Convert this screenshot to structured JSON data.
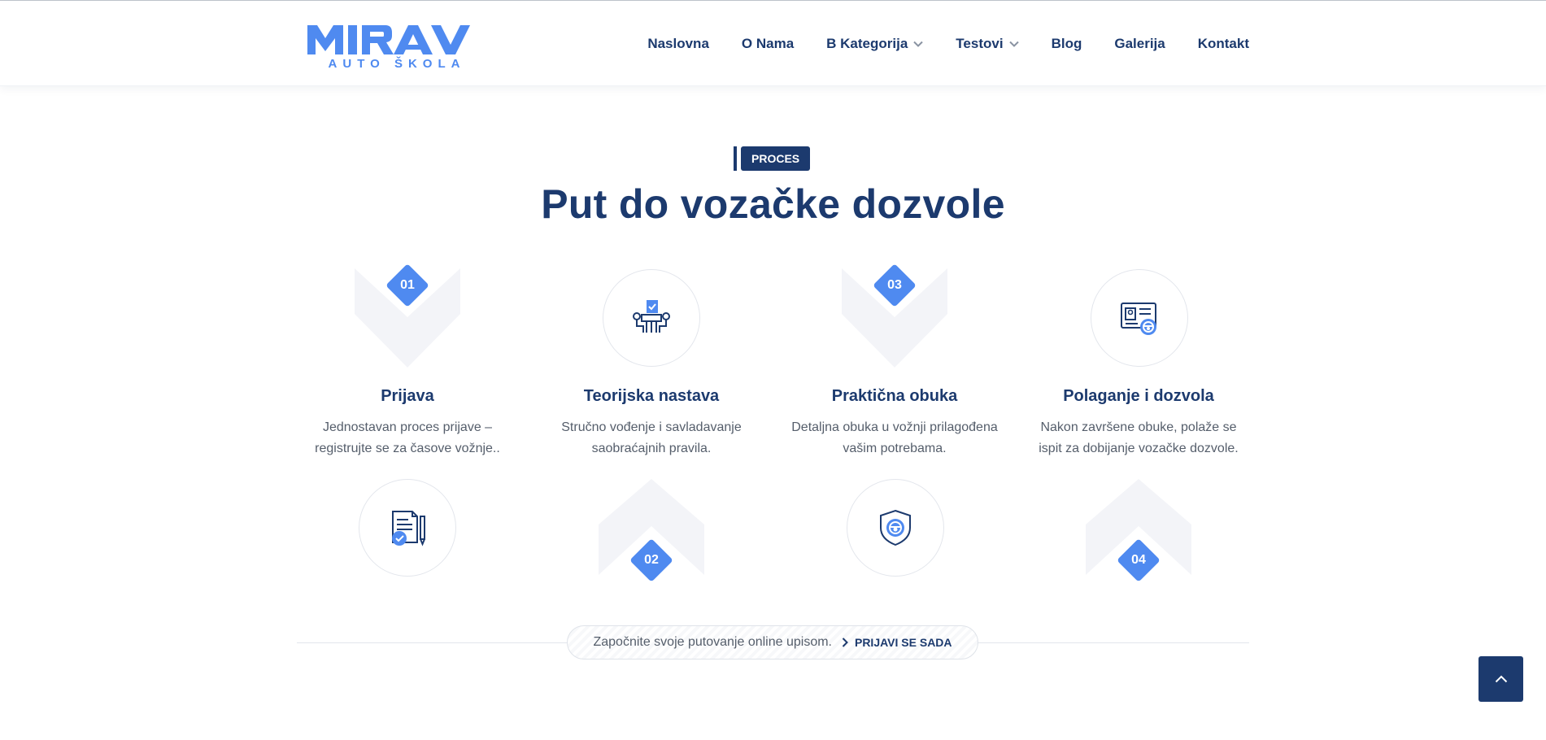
{
  "brand": {
    "name": "MIRAV",
    "subtitle": "AUTO ŠKOLA",
    "color": "#4f8af0"
  },
  "nav": {
    "items": [
      {
        "label": "Naslovna",
        "dropdown": false
      },
      {
        "label": "O Nama",
        "dropdown": false
      },
      {
        "label": "B Kategorija",
        "dropdown": true
      },
      {
        "label": "Testovi",
        "dropdown": true
      },
      {
        "label": "Blog",
        "dropdown": false
      },
      {
        "label": "Galerija",
        "dropdown": false
      },
      {
        "label": "Kontakt",
        "dropdown": false
      }
    ]
  },
  "section": {
    "tag": "PROCES",
    "title": "Put do vozačke dozvole"
  },
  "steps": [
    {
      "number": "01",
      "title": "Prijava",
      "desc_line1": "Jednostavan proces prijave –",
      "desc_line2": "registrujte se za časove vožnje..",
      "icon": "document-check-icon"
    },
    {
      "number": "02",
      "title": "Teorijska nastava",
      "desc_line1": "Stručno vođenje i savladavanje",
      "desc_line2": "saobraćajnih pravila.",
      "icon": "classroom-icon"
    },
    {
      "number": "03",
      "title": "Praktična obuka",
      "desc_line1": "Detaljna obuka u vožnji prilagođena",
      "desc_line2": "vašim potrebama.",
      "icon": "steering-shield-icon"
    },
    {
      "number": "04",
      "title": "Polaganje i dozvola",
      "desc_line1": "Nakon završene obuke, polaže se",
      "desc_line2": "ispit za dobijanje vozačke dozvole.",
      "icon": "license-card-icon"
    }
  ],
  "cta": {
    "text": "Započnite svoje putovanje online upisom.",
    "link": "PRIJAVI SE SADA"
  },
  "colors": {
    "navy": "#1c3a6e",
    "accent": "#4f8af0",
    "shape": "#f3f4f8"
  }
}
